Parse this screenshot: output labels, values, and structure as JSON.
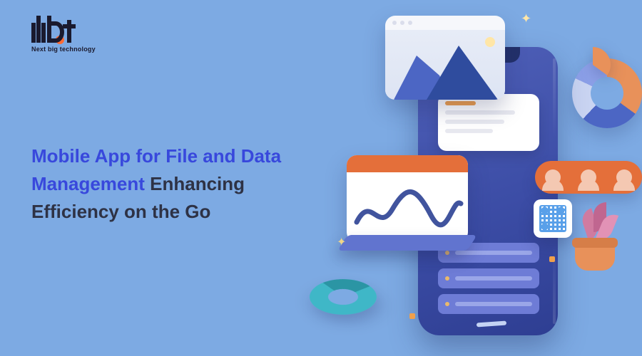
{
  "logo": {
    "tagline": "Next big technology"
  },
  "hero": {
    "line1_a": "Mobile App for File and Data",
    "line2_a": "Management",
    "line2_b": " Enhancing",
    "line3_b": "Efficiency on the Go"
  },
  "colors": {
    "bg": "#7DAAE3",
    "accent": "#3848DC",
    "text": "#2E3245",
    "phone": "#3C4DA6",
    "orange": "#E46F3A",
    "teal": "#3FB7C7",
    "pink": "#D07BA0"
  },
  "illustration": {
    "picture_card": {
      "type": "landscape-photo-placeholder"
    },
    "widget_card": {
      "rows": 4
    },
    "chart_card": {
      "type": "line-scribble"
    },
    "list_rows": 3,
    "people_pill": {
      "avatars": 3
    },
    "qr_tile": true,
    "pie_chart": true,
    "teal_ring": true,
    "leaf_pot": true
  }
}
